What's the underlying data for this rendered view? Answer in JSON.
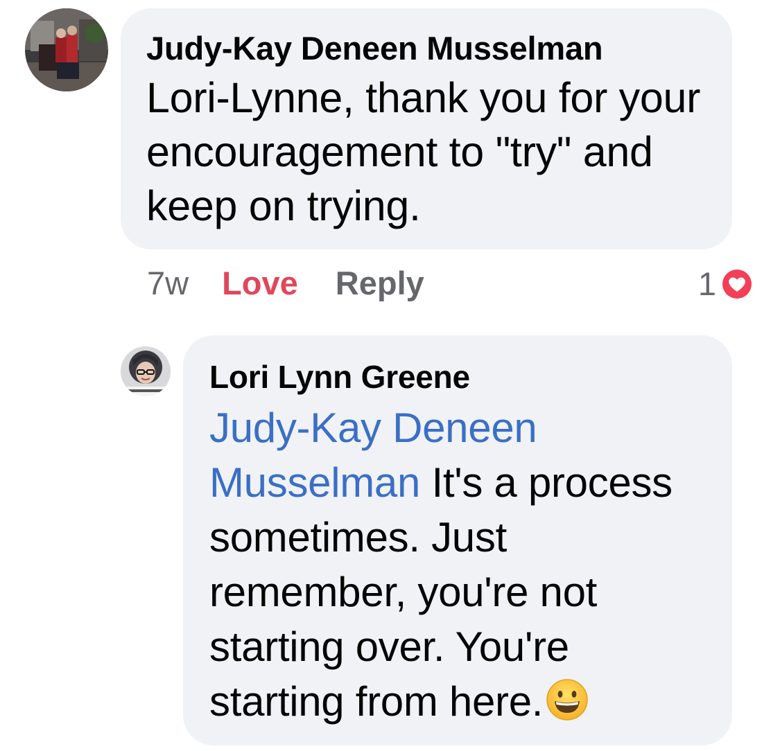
{
  "comments": [
    {
      "author": "Judy-Kay Deneen Musselman",
      "text": "Lori-Lynne, thank you for your encouragement to \"try\" and keep on trying.",
      "timestamp": "7w",
      "love_label": "Love",
      "reply_label": "Reply",
      "reaction_count": "1",
      "reaction_icon": "heart-icon"
    },
    {
      "author": "Lori Lynn Greene",
      "mention": "Judy-Kay Deneen Musselman",
      "text": "It's a process sometimes. Just remember, you're not starting over. You're starting from here.",
      "emoji": "grinning-face-icon"
    }
  ],
  "colors": {
    "bubble": "#f0f2f5",
    "love": "#e0475b",
    "mention": "#3b6fc6",
    "muted": "#65676b",
    "heart_badge": "#f33e58"
  }
}
